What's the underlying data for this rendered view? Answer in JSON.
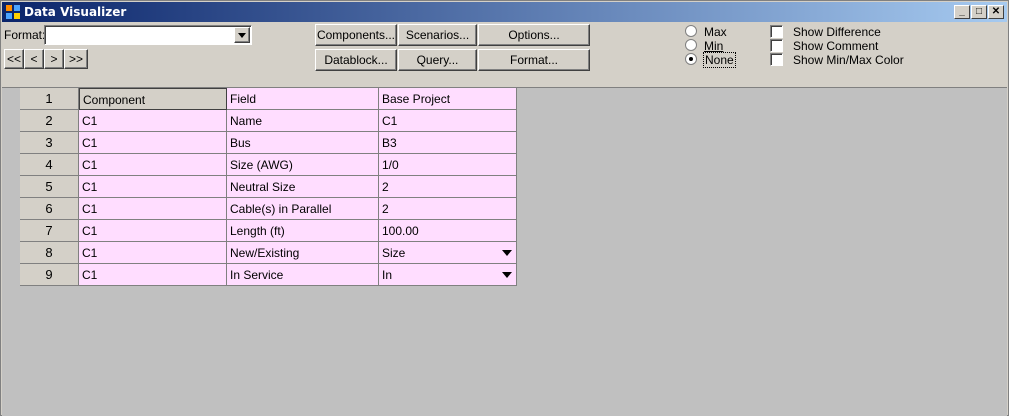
{
  "window": {
    "title": "Data Visualizer"
  },
  "toolbar": {
    "format_label": "Format:",
    "format_value": "",
    "nav": {
      "first": "<<",
      "prev": "<",
      "next": ">",
      "last": ">>"
    },
    "buttons": {
      "components": "Components...",
      "scenarios": "Scenarios...",
      "options": "Options...",
      "datablock": "Datablock...",
      "query": "Query...",
      "format": "Format..."
    },
    "radios": {
      "max": "Max",
      "min": "Min",
      "none": "None",
      "selected": "None"
    },
    "checks": {
      "show_difference": "Show Difference",
      "show_comment": "Show Comment",
      "show_minmax_color": "Show Min/Max Color"
    }
  },
  "grid": {
    "header": {
      "num": "1",
      "component": "Component",
      "field": "Field",
      "base": "Base Project"
    },
    "rows": [
      {
        "num": "2",
        "component": "C1",
        "field": "Name",
        "value": "C1"
      },
      {
        "num": "3",
        "component": "C1",
        "field": "Bus",
        "value": "B3"
      },
      {
        "num": "4",
        "component": "C1",
        "field": "Size (AWG)",
        "value": "1/0"
      },
      {
        "num": "5",
        "component": "C1",
        "field": "Neutral Size",
        "value": "2"
      },
      {
        "num": "6",
        "component": "C1",
        "field": "  Cable(s) in Parallel",
        "value": "2"
      },
      {
        "num": "7",
        "component": "C1",
        "field": "Length (ft)",
        "value": "100.00"
      },
      {
        "num": "8",
        "component": "C1",
        "field": "New/Existing",
        "value": "Size"
      },
      {
        "num": "9",
        "component": "C1",
        "field": "In Service",
        "value": "In"
      }
    ]
  },
  "colors": {
    "row_bg": "#ffddff",
    "title_start": "#0a246a",
    "title_end": "#a6caf0"
  }
}
